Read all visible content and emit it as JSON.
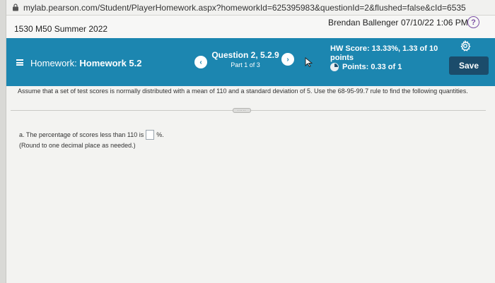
{
  "browser": {
    "url": "mylab.pearson.com/Student/PlayerHomework.aspx?homeworkId=625395983&questionId=2&flushed=false&cId=6535"
  },
  "course": {
    "title": "1530 M50 Summer 2022",
    "user_name": "Brendan Ballenger",
    "datetime": "07/10/22 1:06 PM",
    "help_glyph": "?"
  },
  "homework_bar": {
    "prefix": "Homework: ",
    "name": "Homework 5.2",
    "question": "Question 2, 5.2.9",
    "part": "Part 1 of 3",
    "prev_glyph": "‹",
    "next_glyph": "›",
    "score_line1": "HW Score: 13.33%, 1.33 of 10",
    "score_line2": "points",
    "points": "Points: 0.33 of 1",
    "save_label": "Save",
    "bar_color": "#1c86b0",
    "save_color": "#1b4c6b"
  },
  "question": {
    "text": "Assume that a set of test scores is normally distributed with a mean of 110 and a standard deviation of 5. Use the 68-95-99.7 rule to find the following quantities.",
    "handle_label": "·····",
    "part_a_prefix": "a. The percentage of scores less than 110 is",
    "part_a_suffix": "%.",
    "answer_value": "",
    "round_note": "(Round to one decimal place as needed.)"
  }
}
